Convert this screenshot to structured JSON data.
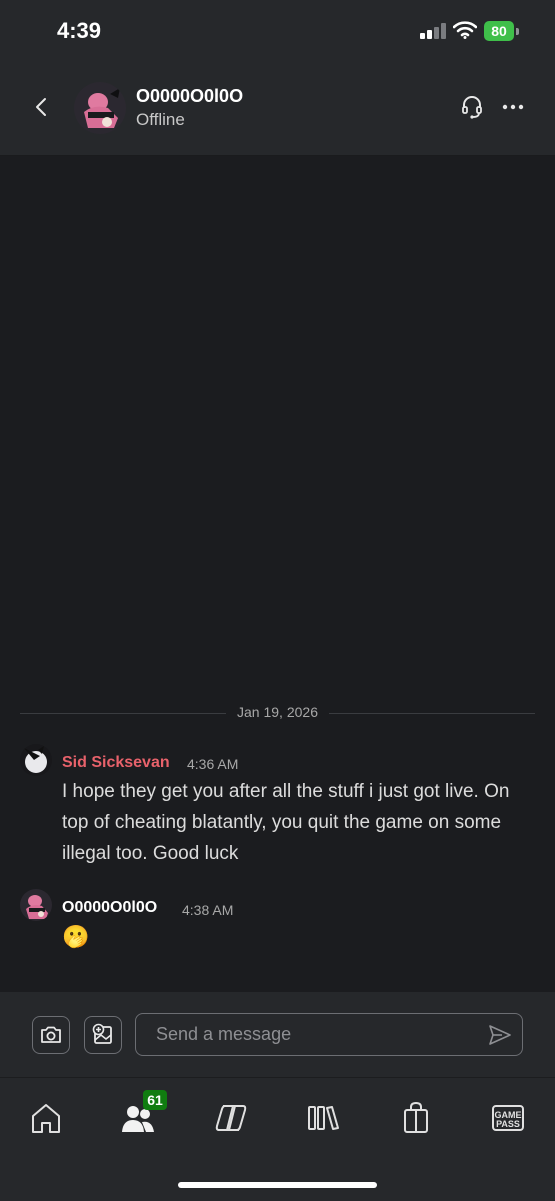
{
  "status_bar": {
    "time": "4:39",
    "battery": "80"
  },
  "header": {
    "contact_name": "O0000O0l0O",
    "contact_status": "Offline"
  },
  "chat": {
    "date_separator": "Jan 19, 2026",
    "messages": [
      {
        "sender": "Sid Sicksevan",
        "time": "4:36 AM",
        "text": "I hope they get you after all the stuff i just got live. On top of cheating blatantly, you quit the game on some illegal too. Good luck",
        "sender_color": "#e8626b"
      },
      {
        "sender": "O0000O0l0O",
        "time": "4:38 AM",
        "text": "🫢",
        "sender_color": "#ffffff"
      }
    ]
  },
  "compose": {
    "placeholder": "Send a message"
  },
  "nav": {
    "items": [
      "home-icon",
      "friends-icon",
      "copilot-icon",
      "library-icon",
      "store-icon",
      "game-pass-icon"
    ],
    "friends_badge": "61",
    "game_pass_label_top": "GAME",
    "game_pass_label_bottom": "PASS"
  },
  "colors": {
    "background": "#1b1c1f",
    "panel": "#26282b",
    "accent_red": "#e8626b",
    "badge_green": "#107c10",
    "battery_green": "#3fbf4a"
  }
}
